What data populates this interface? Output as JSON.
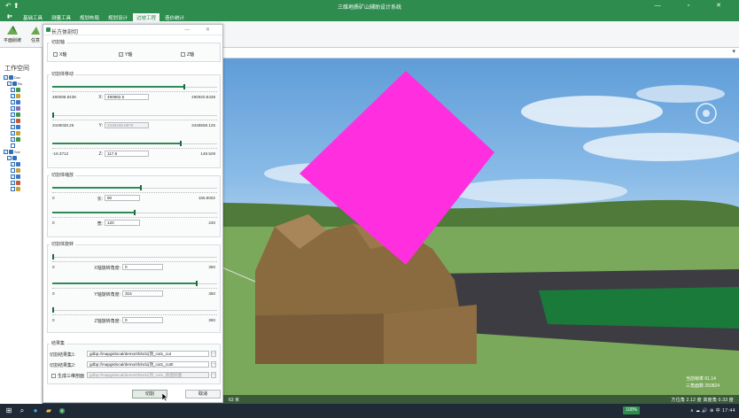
{
  "window": {
    "title": "三维地质矿山辅助设计系统",
    "quick_access": "↶ ⬆",
    "controls": "— ▫ ✕"
  },
  "ribbon_tabs": [
    {
      "label": "▮▾",
      "active": false
    },
    {
      "label": "基础工具",
      "active": false
    },
    {
      "label": "测量工具",
      "active": false
    },
    {
      "label": "规划布局",
      "active": false
    },
    {
      "label": "规划设计",
      "active": false
    },
    {
      "label": "边坡工程",
      "active": true
    },
    {
      "label": "造价统计",
      "active": false
    }
  ],
  "ribbon_buttons": [
    {
      "label": "平面削坡",
      "icon": "slope-cut-icon"
    },
    {
      "label": "任意",
      "icon": "arbitrary-cut-icon"
    }
  ],
  "left_panel": {
    "header": "工作空间",
    "tree": [
      {
        "indent": 0,
        "checked": true,
        "label": "Doc",
        "color": "#2c6fb7"
      },
      {
        "indent": 1,
        "checked": true,
        "label": "Rs",
        "color": "#2c6fb7"
      },
      {
        "indent": 2,
        "checked": true,
        "label": "",
        "color": "#3a9a4a"
      },
      {
        "indent": 2,
        "checked": true,
        "label": "",
        "color": "#c8a23a"
      },
      {
        "indent": 2,
        "checked": true,
        "label": "",
        "color": "#3a7ac8"
      },
      {
        "indent": 2,
        "checked": true,
        "label": "",
        "color": "#8a6ac8"
      },
      {
        "indent": 2,
        "checked": true,
        "label": "",
        "color": "#3a9a4a"
      },
      {
        "indent": 2,
        "checked": true,
        "label": "",
        "color": "#c85a3a"
      },
      {
        "indent": 2,
        "checked": true,
        "label": "",
        "color": "#3a7ac8"
      },
      {
        "indent": 2,
        "checked": true,
        "label": "",
        "color": "#c8a23a"
      },
      {
        "indent": 2,
        "checked": true,
        "label": "",
        "color": "#3a9a4a"
      },
      {
        "indent": 2,
        "checked": false,
        "label": "",
        "color": "#ffffff"
      },
      {
        "indent": 0,
        "checked": true,
        "label": "Sce",
        "color": "#2c6fb7"
      },
      {
        "indent": 1,
        "checked": true,
        "label": "",
        "color": "#2c6fb7"
      },
      {
        "indent": 2,
        "checked": true,
        "label": "",
        "color": "#3a7ac8"
      },
      {
        "indent": 2,
        "checked": false,
        "label": "",
        "color": "#c8a23a"
      },
      {
        "indent": 2,
        "checked": true,
        "label": "",
        "color": "#3a7ac8"
      },
      {
        "indent": 2,
        "checked": true,
        "label": "",
        "color": "#c85a3a"
      },
      {
        "indent": 2,
        "checked": false,
        "label": "",
        "color": "#c8a23a"
      }
    ]
  },
  "dialog": {
    "title": "长方体剖切",
    "controls": "— ✕",
    "axis_group": {
      "label": "切割轴",
      "options": [
        {
          "label": "X轴",
          "checked": false
        },
        {
          "label": "Y轴",
          "checked": true
        },
        {
          "label": "Z轴",
          "checked": false
        }
      ]
    },
    "move_group": {
      "label": "切割体移动",
      "rows": [
        {
          "min": "490088.8438",
          "axis_label": "X:",
          "value": "490862.5",
          "max": "490920.8438",
          "fraction": 0.8,
          "disabled": false
        },
        {
          "min": "3448038.25",
          "axis_label": "Y:",
          "value": "3448446.6875",
          "max": "3448558.125",
          "fraction": 0.0,
          "disabled": true
        },
        {
          "min": "-16.3712",
          "axis_label": "Z:",
          "value": "117.5",
          "max": "149.529",
          "fraction": 0.78,
          "disabled": false
        }
      ]
    },
    "scale_group": {
      "label": "切割体缩放",
      "rows": [
        {
          "min": "0",
          "axis_label": "长:",
          "value": "90",
          "max": "165.9002",
          "fraction": 0.54
        },
        {
          "min": "0",
          "axis_label": "宽:",
          "value": "120",
          "max": "240",
          "fraction": 0.5
        }
      ]
    },
    "rotate_group": {
      "label": "切割体旋转",
      "rows": [
        {
          "min": "0",
          "axis_label": "X轴旋转角度:",
          "value": "0",
          "max": "360",
          "fraction": 0.0
        },
        {
          "min": "0",
          "axis_label": "Y轴旋转角度:",
          "value": "315",
          "max": "360",
          "fraction": 0.875
        },
        {
          "min": "0",
          "axis_label": "Z轴旋转角度:",
          "value": "0",
          "max": "360",
          "fraction": 0.0
        }
      ]
    },
    "result_group": {
      "label": "结果集",
      "rows": [
        {
          "label": "切割结果集1:",
          "value": "gdbp://mapgislocal/demo/sfcls/山顶_cut1_cut",
          "disabled": false
        },
        {
          "label": "切割结果集2:",
          "value": "gdbp://mapgislocal/demo/sfcls/山顶_cut1_cut0",
          "disabled": false
        },
        {
          "label": "生成三维剖面",
          "value": "gdbp://mapgislocal/demo/sfcls/山顶_cut1_剖面剖面",
          "disabled": true,
          "checkbox": true
        }
      ]
    },
    "buttons": {
      "ok": "切割",
      "cancel": "取消"
    }
  },
  "viewport": {
    "status_left": "63 米",
    "status_right": "方位角  2.12 度  高度角  0.33 度",
    "fps_label": "当前帧率  61.14",
    "tri_label": "三角面数  250824",
    "pink_box_color": "#ff2fe0"
  },
  "taskbar": {
    "lang": "100%",
    "tray": "∧ ☁ 🔊 ⊕ 中 17:44"
  }
}
